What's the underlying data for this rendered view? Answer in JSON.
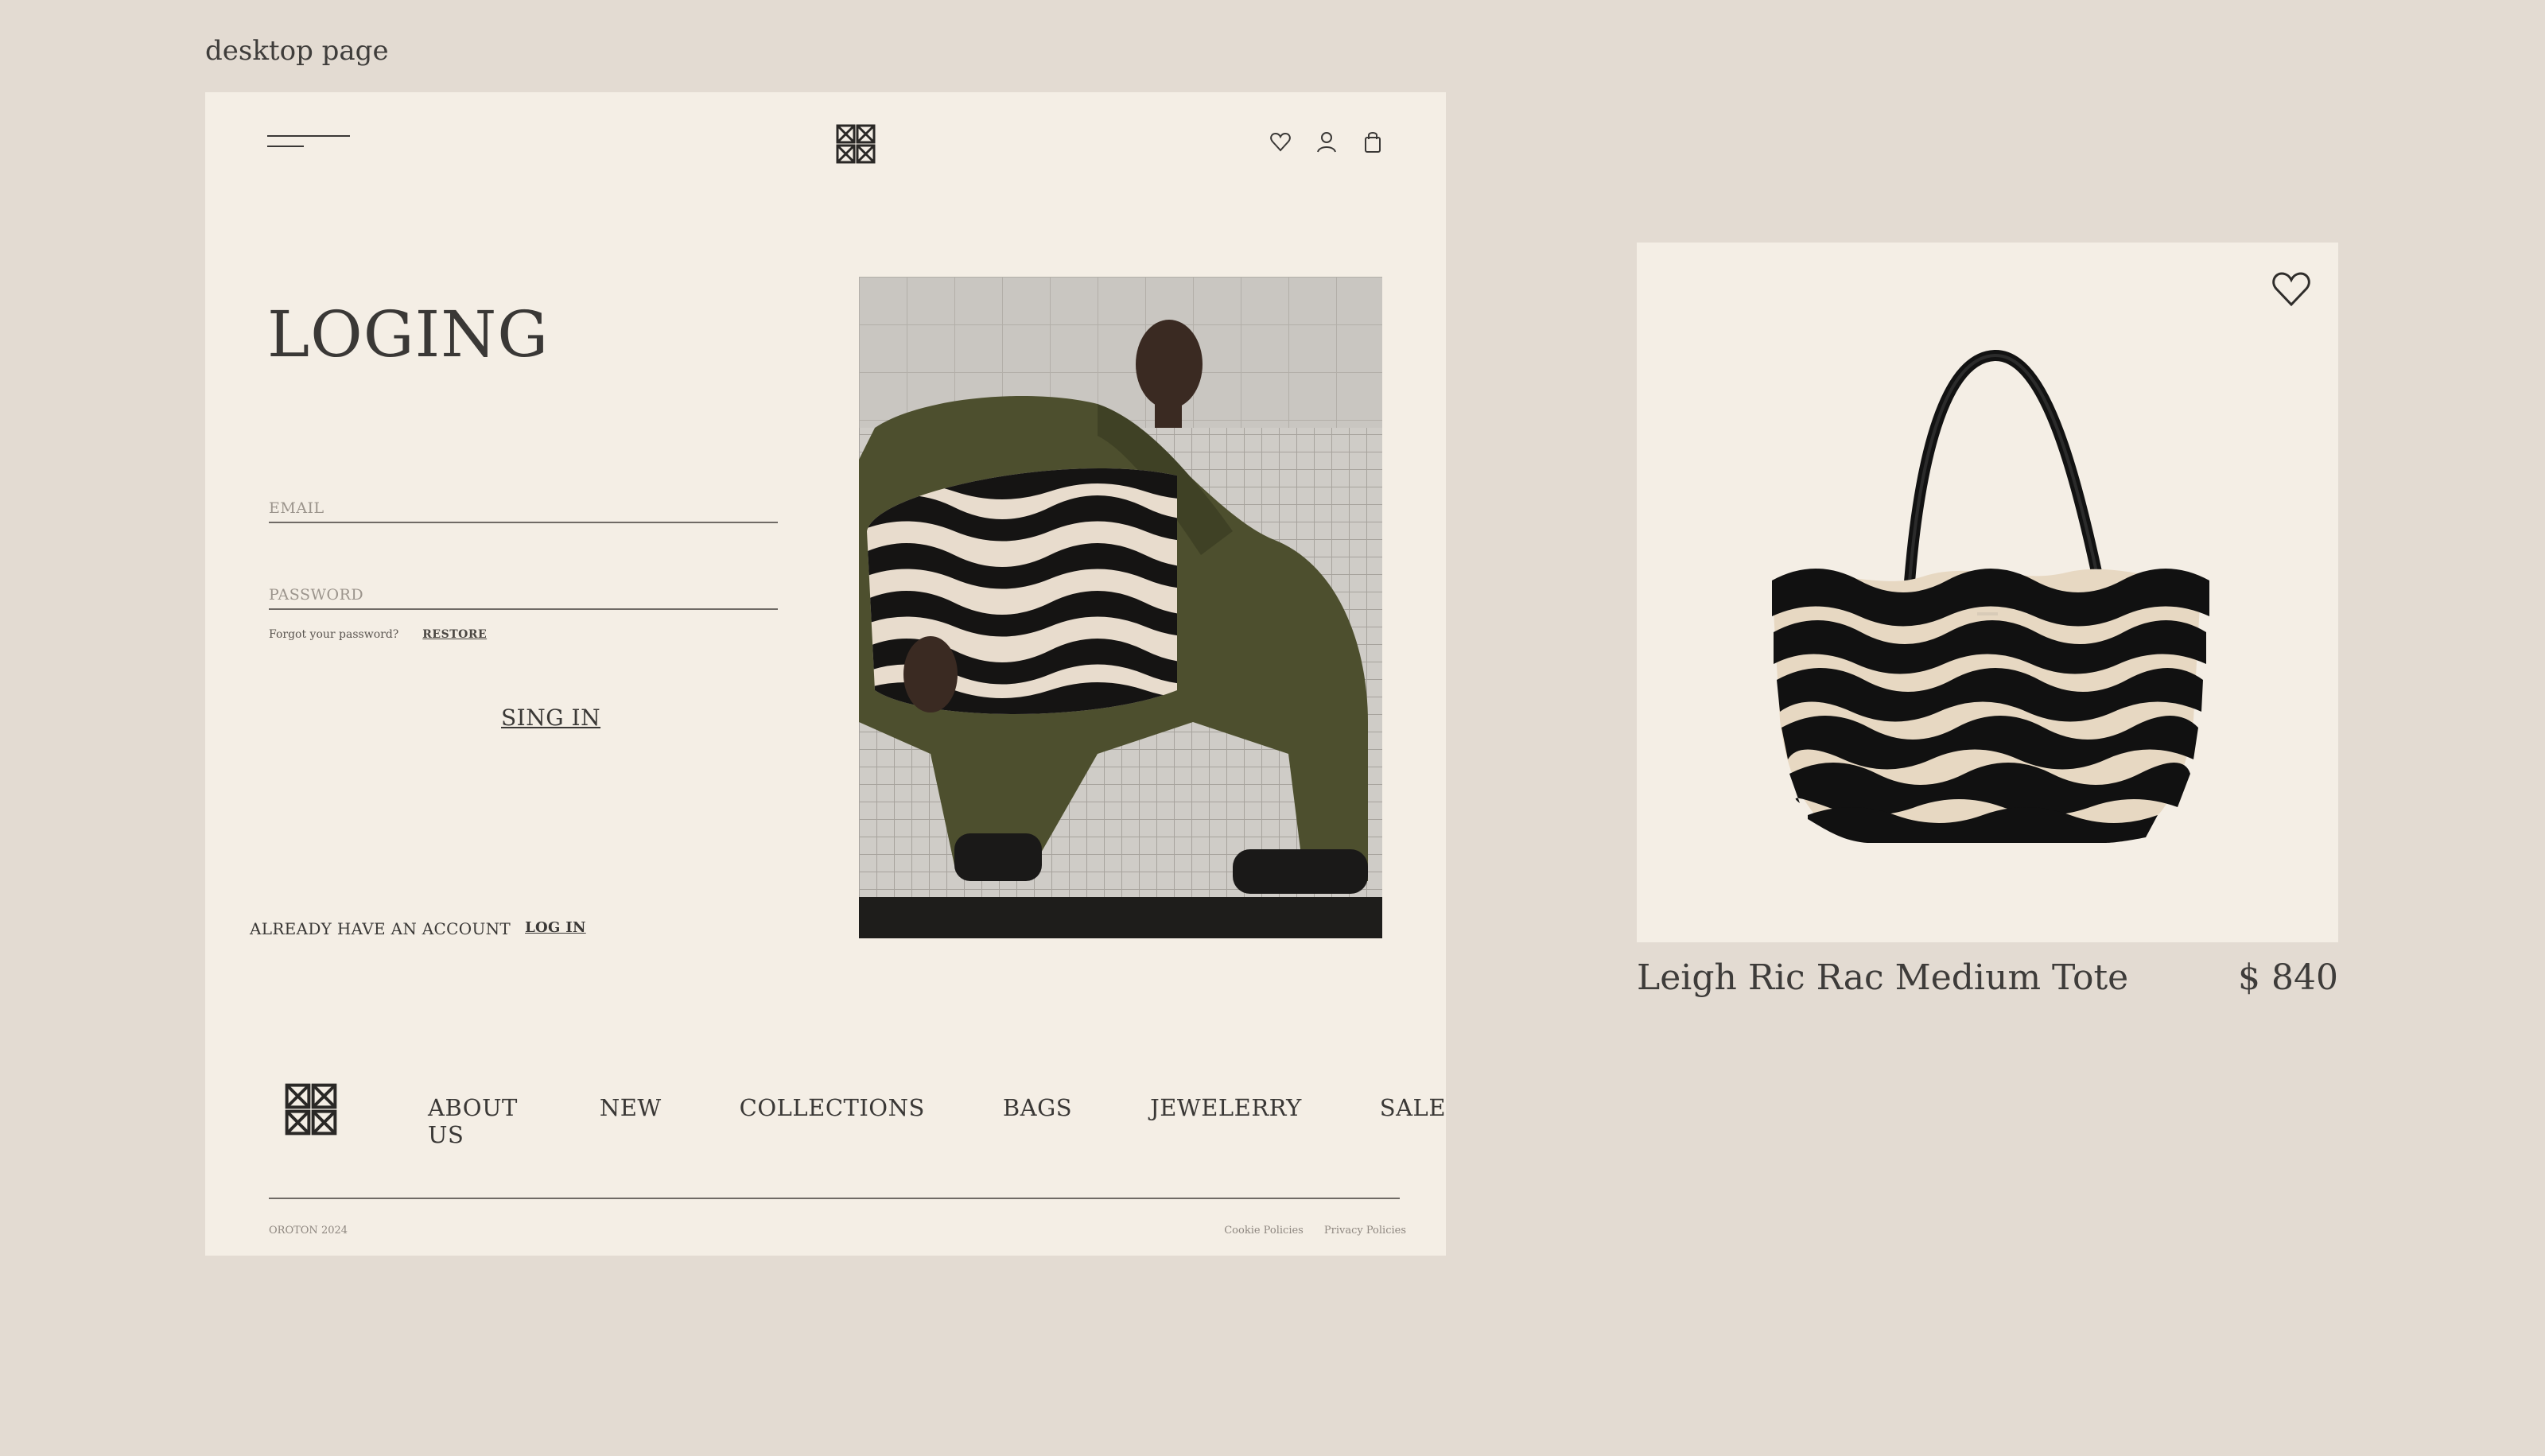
{
  "canvas_label": "desktop page",
  "login": {
    "title": "LOGING",
    "email_placeholder": "EMAIL",
    "password_placeholder": "PASSWORD",
    "forgot_text": "Forgot your password?",
    "restore_label": "RESTORE",
    "signin_label": "SING IN",
    "account_text": "ALREADY HAVE AN ACCOUNT",
    "login_link": "LOG IN"
  },
  "header": {
    "icons": [
      "heart-icon",
      "user-icon",
      "bag-icon"
    ]
  },
  "footer": {
    "nav": [
      "ABOUT US",
      "NEW",
      "COLLECTIONS",
      "BAGS",
      "JEWELERRY",
      "SALE"
    ],
    "copyright": "OROTON 2024",
    "legal": [
      "Cookie Policies",
      "Privacy Policies"
    ]
  },
  "product": {
    "name": "Leigh Ric Rac Medium Tote",
    "price": "$ 840"
  },
  "colors": {
    "background": "#e3dbd2",
    "panel": "#f4eee5",
    "text": "#3a3836",
    "bag": "#141414",
    "olive": "#4d4f2e"
  }
}
